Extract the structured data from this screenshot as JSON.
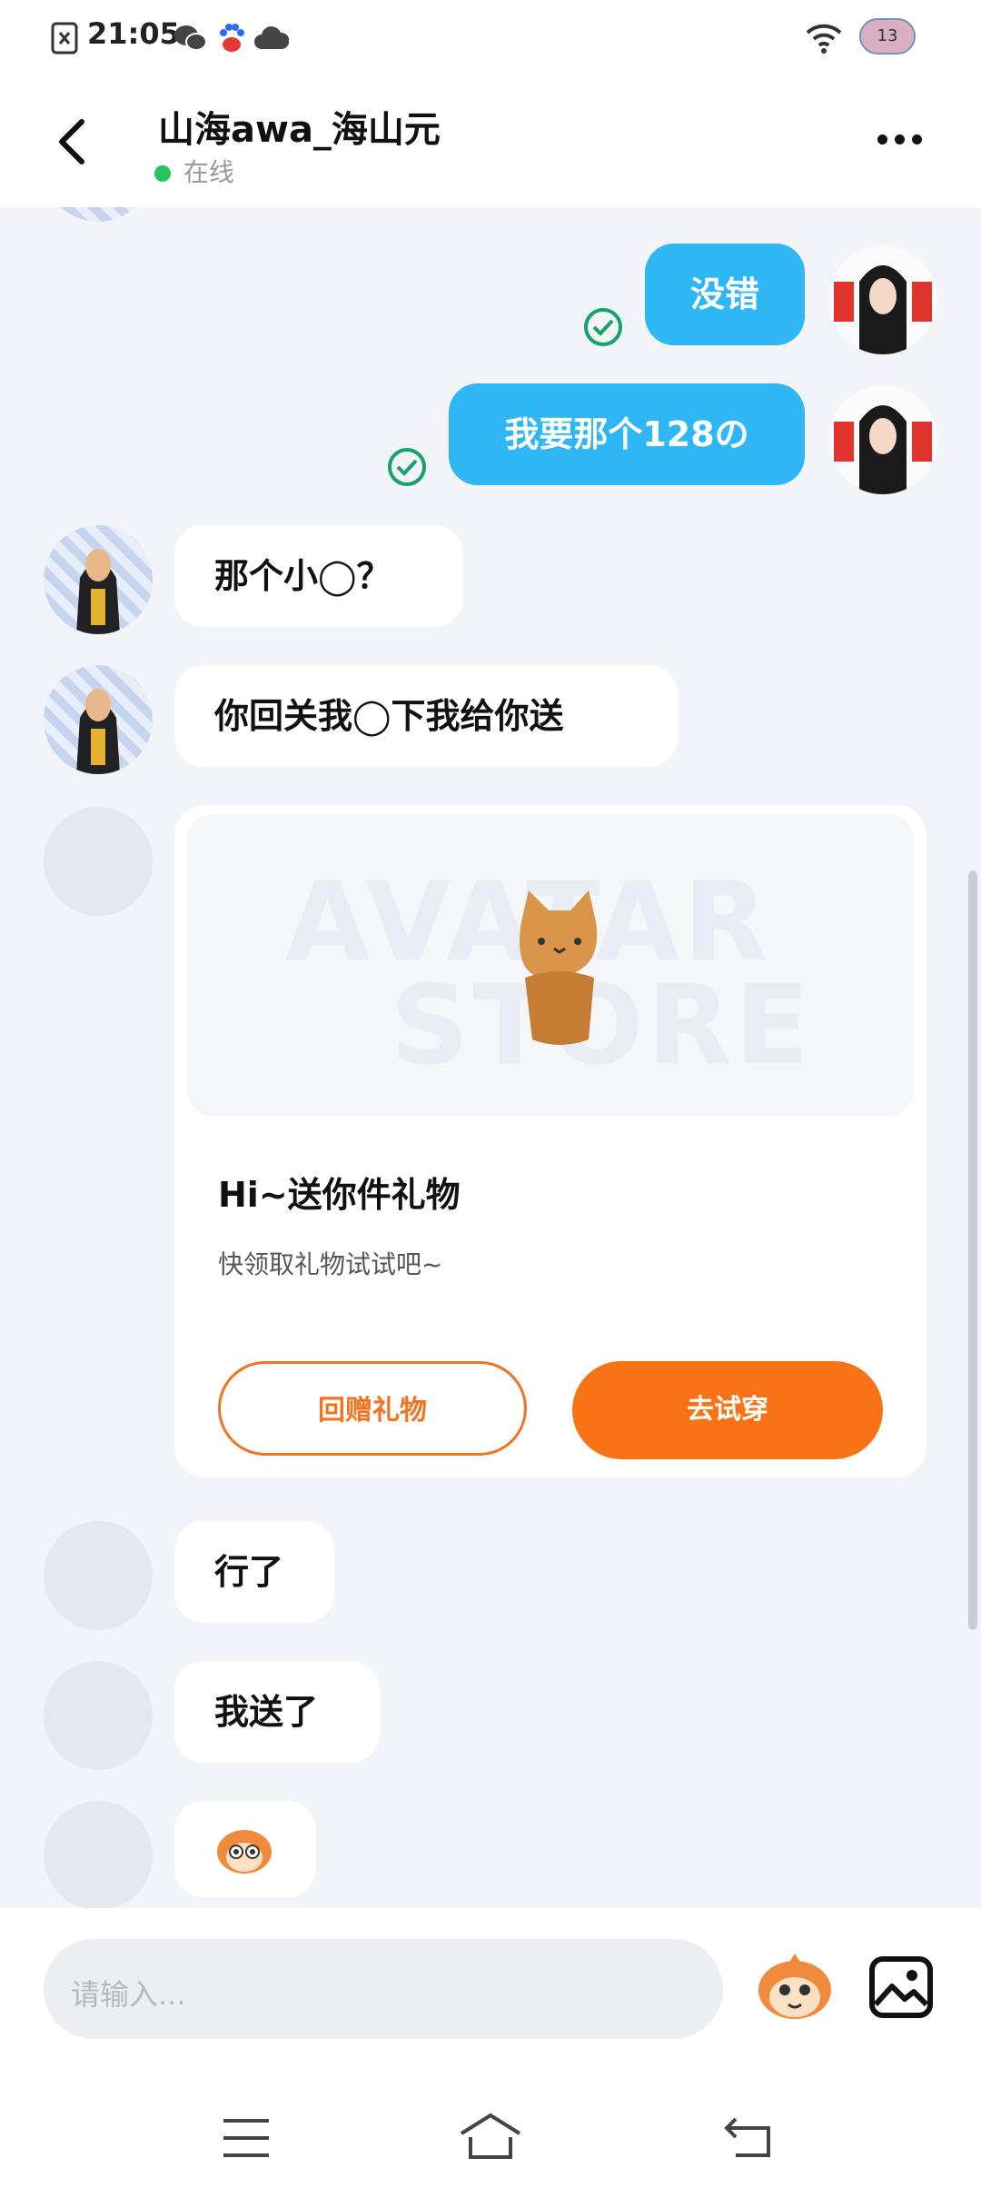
{
  "status_bar": {
    "time": "21:05",
    "icons": [
      "sim-icon",
      "wechat-icon",
      "baidu-paw-icon",
      "cloud-icon",
      "wifi-icon",
      "fish-badge-icon"
    ],
    "badge_text": "13"
  },
  "header": {
    "title": "山海awa_海山元",
    "status": "在线",
    "status_color": "#22c55e"
  },
  "messages": [
    {
      "side": "right",
      "text": "没错",
      "read": true
    },
    {
      "side": "right",
      "text": "我要那个128の",
      "read": true
    },
    {
      "side": "left",
      "text": "那个小◯？"
    },
    {
      "side": "left",
      "text": "你回关我◯下我给你送"
    },
    {
      "side": "left",
      "type": "gift_card"
    },
    {
      "side": "left",
      "text": "行了"
    },
    {
      "side": "left",
      "text": "我送了"
    },
    {
      "side": "left",
      "type": "sticker",
      "sticker": "monkey-face-sticker"
    }
  ],
  "gift_card": {
    "watermark_line1": "AVATAR",
    "watermark_line2": "STORE",
    "title": "Hi~送你件礼物",
    "subtitle": "快领取礼物试试吧~",
    "btn_return": "回赠礼物",
    "btn_try": "去试穿",
    "accent_color": "#f97316"
  },
  "input_bar": {
    "placeholder": "请输入...",
    "icons": [
      "emoji-monkey-icon",
      "image-icon"
    ]
  },
  "nav_bar": {
    "icons": [
      "menu-icon",
      "home-icon",
      "back-nav-icon"
    ]
  },
  "colors": {
    "bubble_right": "#2fb7f5",
    "bubble_left": "#ffffff",
    "chat_bg": "#f2f4f9",
    "read_check": "#16a36a"
  }
}
